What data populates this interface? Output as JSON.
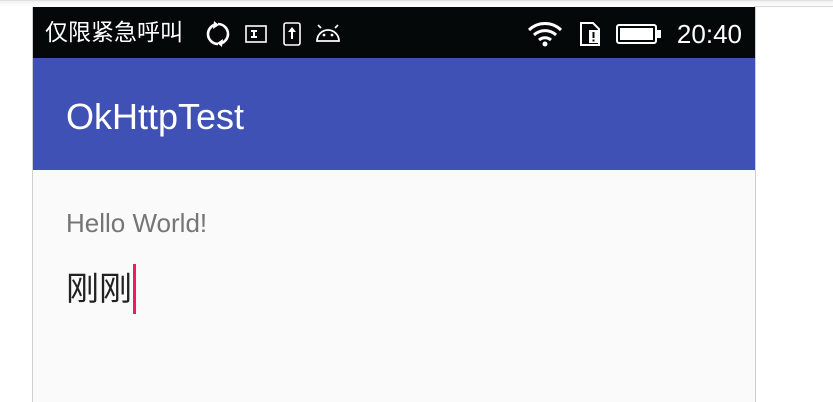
{
  "status_bar": {
    "carrier": "仅限紧急呼叫",
    "time": "20:40",
    "left_icons": [
      "sync-icon",
      "sim-card-icon",
      "upload-notification-icon",
      "android-debug-icon"
    ],
    "right_icons": [
      "wifi-icon",
      "sim-no-service-icon",
      "battery-icon"
    ]
  },
  "app_bar": {
    "title": "OkHttpTest",
    "color": "#3f51b5"
  },
  "content": {
    "hello_text": "Hello World!",
    "edit_value": "刚刚",
    "cursor_color": "#e91e63"
  }
}
